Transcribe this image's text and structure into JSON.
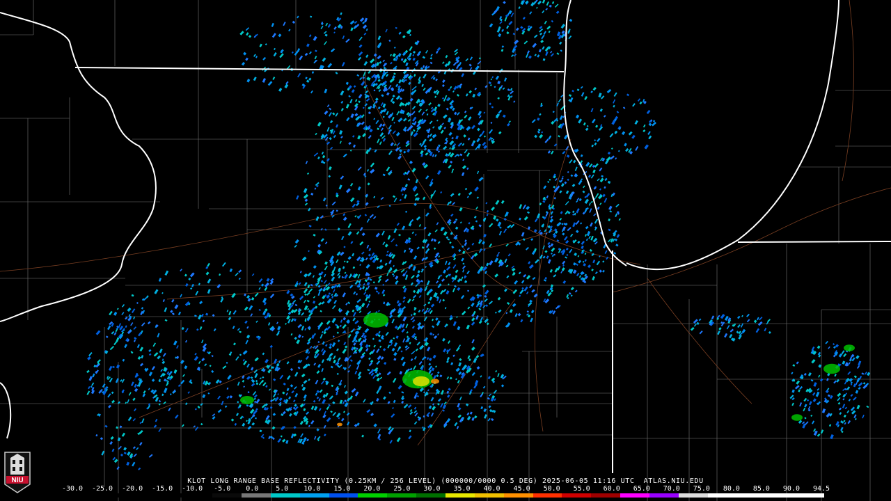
{
  "product": {
    "caption": "KLOT LONG RANGE BASE REFLECTIVITY (0.25KM / 256 LEVEL) (000000/0000 0.5 DEG) 2025-06-05 11:16 UTC  ATLAS.NIU.EDU"
  },
  "colorbar": {
    "ticks": [
      "-30.0",
      "-25.0",
      "-20.0",
      "-15.0",
      "-10.0",
      "-5.0",
      "0.0",
      "5.0",
      "10.0",
      "15.0",
      "20.0",
      "25.0",
      "30.0",
      "35.0",
      "40.0",
      "45.0",
      "50.0",
      "55.0",
      "60.0",
      "65.0",
      "70.0",
      "75.0",
      "80.0",
      "85.0",
      "90.0",
      "94.5"
    ],
    "colors": [
      "#000000",
      "#000000",
      "#000000",
      "#000000",
      "#000000",
      "#0a0a0a",
      "#777777",
      "#00c8c8",
      "#00a0f0",
      "#0050f0",
      "#00d000",
      "#00a000",
      "#007000",
      "#e8e800",
      "#f0c000",
      "#ff9000",
      "#ff3000",
      "#d00000",
      "#a00000",
      "#ff00ff",
      "#9900ff",
      "#dddddd",
      "#ffffff",
      "#ffffff",
      "#ffffff",
      "#ffffff"
    ]
  },
  "logo": {
    "text": "NIU",
    "color": "#c8102e"
  },
  "map_colors": {
    "state_borders": "#ffffff",
    "county_lines": "#888888",
    "highways": "#8a4a2a",
    "background": "#000000"
  }
}
